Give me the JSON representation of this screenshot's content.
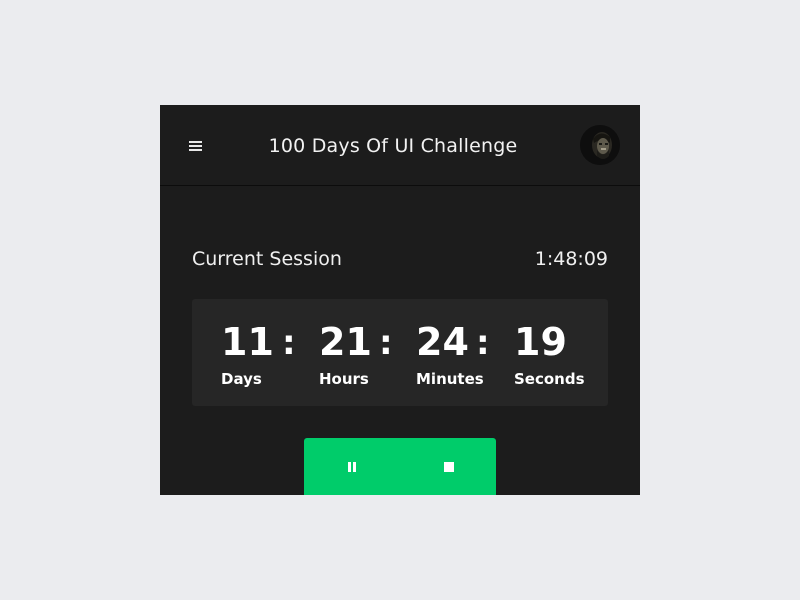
{
  "header": {
    "title": "100 Days Of UI Challenge",
    "menu_icon": "hamburger-menu-icon",
    "avatar": "user-avatar"
  },
  "session": {
    "label": "Current Session",
    "time": "1:48:09"
  },
  "countdown": {
    "separator": ":",
    "units": [
      {
        "value": "11",
        "label": "Days"
      },
      {
        "value": "21",
        "label": "Hours"
      },
      {
        "value": "24",
        "label": "Minutes"
      },
      {
        "value": "19",
        "label": "Seconds"
      }
    ]
  },
  "controls": {
    "pause_icon": "pause-icon",
    "stop_icon": "stop-icon",
    "accent_color": "#00cc6a"
  },
  "colors": {
    "page_background": "#ebecef",
    "card_background": "#1c1c1c",
    "timer_background": "#262626"
  }
}
